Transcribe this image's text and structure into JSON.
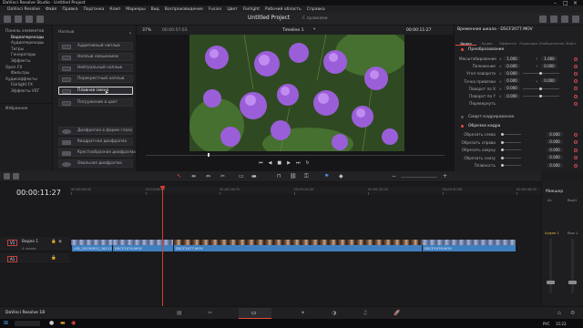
{
  "system_bar": {
    "title": "DaVinci Resolve Studio - Untitled Project"
  },
  "menu": {
    "items": [
      "DaVinci Resolve",
      "Файл",
      "Правка",
      "Подгонка",
      "Клип",
      "Маркеры",
      "Вид",
      "Воспроизведение",
      "Fusion",
      "Цвет",
      "Fairlight",
      "Рабочий область",
      "Справка"
    ],
    "project_title": "Untitled Project"
  },
  "viewer_header": {
    "zoom": "37%",
    "timecode_left": "00:00:57:03",
    "timeline_name": "Timeline 1",
    "timecode_right": "00:00:11:27",
    "edited_tag": "С правками"
  },
  "sidebar": {
    "items": [
      {
        "label": "Панель элементов",
        "level": 0,
        "selected": false
      },
      {
        "label": "Видеопереходы",
        "level": 1,
        "selected": true
      },
      {
        "label": "Аудиопереходы",
        "level": 1,
        "selected": false
      },
      {
        "label": "Титры",
        "level": 1,
        "selected": false
      },
      {
        "label": "Генераторы",
        "level": 1,
        "selected": false
      },
      {
        "label": "Эффекты",
        "level": 1,
        "selected": false
      },
      {
        "label": "Open FX",
        "level": 0,
        "selected": false
      },
      {
        "label": "Фильтры",
        "level": 1,
        "selected": false
      },
      {
        "label": "Аудиоэффекты",
        "level": 0,
        "selected": false
      },
      {
        "label": "Fairlight FX",
        "level": 1,
        "selected": false
      },
      {
        "label": "Эффекты VST",
        "level": 1,
        "selected": false
      }
    ],
    "favorites_label": "Избранное"
  },
  "effects_panel": {
    "section1": "Наплыв",
    "tiles1": [
      {
        "label": "Аддитивный наплыв",
        "selected": false
      },
      {
        "label": "Наплыв смешением",
        "selected": false
      },
      {
        "label": "Нейтральный наплыв",
        "selected": false
      },
      {
        "label": "Перекрестный наплыв",
        "selected": false
      },
      {
        "label": "Плавная смена",
        "selected": true
      },
      {
        "label": "Погружение в цвет",
        "selected": false
      }
    ],
    "section2": "Диафрагма",
    "tiles2": [
      {
        "label": "Диафрагма в форме глаза"
      },
      {
        "label": "Квадратная диафрагма"
      },
      {
        "label": "Крестообразная диафрагма"
      },
      {
        "label": "Овальная диафрагма"
      }
    ]
  },
  "inspector": {
    "header": "Временная шкала - DSCF2077.MOV",
    "tabs": [
      "Видео",
      "Аудио",
      "Эффекты",
      "Переходы",
      "Изображение",
      "Файл"
    ],
    "section_transform": "Преобразование",
    "rows": [
      {
        "label": "Масштабирование",
        "x": "1.000",
        "y": "1.000"
      },
      {
        "label": "Положение",
        "x": "0.000",
        "y": "0.000"
      },
      {
        "label": "Угол поворота",
        "x": "0.000",
        "y": ""
      },
      {
        "label": "Точка привязки",
        "x": "0.000",
        "y": "0.000"
      },
      {
        "label": "Поворот по X",
        "x": "0.000",
        "y": ""
      },
      {
        "label": "Поворот по Y",
        "x": "0.000",
        "y": ""
      },
      {
        "label": "Перевернуть",
        "x": "",
        "y": ""
      }
    ],
    "section_smart": "Смарт-кадрирование",
    "section_crop": "Обрезка кадра",
    "crop_rows": [
      {
        "label": "Обрезать слева",
        "v": "0.000"
      },
      {
        "label": "Обрезать справа",
        "v": "0.000"
      },
      {
        "label": "Обрезать сверху",
        "v": "0.000"
      },
      {
        "label": "Обрезать снизу",
        "v": "0.000"
      },
      {
        "label": "Плавность",
        "v": "0.000"
      }
    ]
  },
  "timeline": {
    "timecode": "00:00:11:27",
    "ruler_marks": [
      "00:00:00:00",
      "00:00:08:00",
      "00:00:16:00",
      "00:00:24:00",
      "00:00:32:00",
      "00:00:40:00",
      "00:00:48:00",
      "00:00:56:00",
      "00:01:04:00",
      "00:01:12:00"
    ],
    "tracks": [
      {
        "id": "V1",
        "name": "Видео 1",
        "clip_count": "4 клипа"
      },
      {
        "id": "A1",
        "name": "",
        "clip_count": ""
      }
    ],
    "clips": [
      {
        "label": "VID_20230912_181123...",
        "color": "#3f7fbf"
      },
      {
        "label": "DSCF2074.MOV",
        "color": "#3f7fbf"
      },
      {
        "label": "DSCF2077.MOV",
        "color": "#3f7fbf"
      },
      {
        "label": "DSCF2078.MOV",
        "color": "#3f7fbf"
      }
    ]
  },
  "mixer": {
    "title": "Микшер",
    "ch1": "A1",
    "ch2": "Вых1",
    "ch3": "Аудио 1",
    "ch4": "Вых 1"
  },
  "app_footer": {
    "label": "DaVinci Resolve 18"
  },
  "taskbar": {
    "lang": "РУС",
    "time": "15:23"
  },
  "colors": {
    "accent": "#e64b3c",
    "clip": "#3f7fbf",
    "playhead": "#e03a30"
  }
}
